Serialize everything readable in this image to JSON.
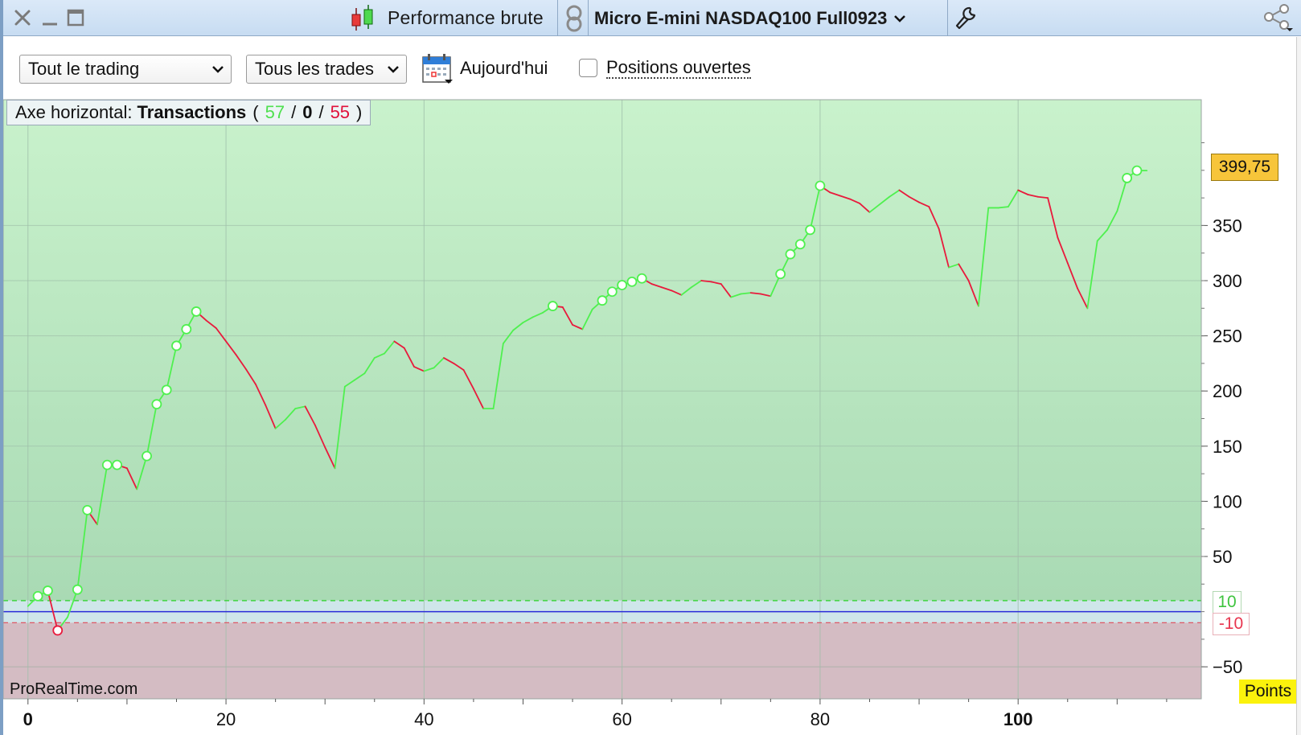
{
  "titlebar": {
    "panel_title": "Performance brute",
    "instrument": "Micro E-mini NASDAQ100 Full0923"
  },
  "toolbar": {
    "period_select": "Tout le trading",
    "trades_select": "Tous les trades",
    "today_label": "Aujourd'hui",
    "open_positions_label": "Positions ouvertes",
    "open_positions_checked": false
  },
  "axis_info": {
    "prefix": "Axe horizontal:",
    "mode": "Transactions",
    "open_paren": "(",
    "wins": "57",
    "sep1": "/",
    "neutral": "0",
    "sep2": "/",
    "losses": "55",
    "close_paren": ")"
  },
  "watermark": "ProRealTime.com",
  "units": "Points",
  "last_value_label": "399,75",
  "upper_threshold_label": "10",
  "lower_threshold_label": "-10",
  "colors": {
    "gain": "#4ff04f",
    "loss": "#e81a3c",
    "badge": "#f7c53a"
  },
  "chart_data": {
    "type": "line",
    "x_ticks": [
      {
        "value": 0,
        "label": "0",
        "major": true
      },
      {
        "value": 20,
        "label": "20",
        "major": false
      },
      {
        "value": 40,
        "label": "40",
        "major": false
      },
      {
        "value": 60,
        "label": "60",
        "major": false
      },
      {
        "value": 80,
        "label": "80",
        "major": false
      },
      {
        "value": 100,
        "label": "100",
        "major": true
      }
    ],
    "y_ticks": [
      {
        "value": 350,
        "label": "350"
      },
      {
        "value": 300,
        "label": "300"
      },
      {
        "value": 250,
        "label": "250"
      },
      {
        "value": 200,
        "label": "200"
      },
      {
        "value": 150,
        "label": "150"
      },
      {
        "value": 100,
        "label": "100"
      },
      {
        "value": 50,
        "label": "50"
      },
      {
        "value": -50,
        "label": "−50"
      }
    ],
    "xlim": [
      -2.5,
      118.5
    ],
    "ylim": [
      -79,
      464
    ],
    "grid": true,
    "upper_threshold": 10,
    "lower_threshold": -10,
    "zero_line": 0,
    "last_value": 399.75,
    "x": [
      0,
      1,
      2,
      3,
      4,
      5,
      6,
      7,
      8,
      9,
      10,
      11,
      12,
      13,
      14,
      15,
      16,
      17,
      18,
      19,
      20,
      21,
      22,
      23,
      24,
      25,
      26,
      27,
      28,
      29,
      30,
      31,
      32,
      33,
      34,
      35,
      36,
      37,
      38,
      39,
      40,
      41,
      42,
      43,
      44,
      45,
      46,
      47,
      48,
      49,
      50,
      51,
      52,
      53,
      54,
      55,
      56,
      57,
      58,
      59,
      60,
      61,
      62,
      63,
      64,
      65,
      66,
      67,
      68,
      69,
      70,
      71,
      72,
      73,
      74,
      75,
      76,
      77,
      78,
      79,
      80,
      81,
      82,
      83,
      84,
      85,
      86,
      87,
      88,
      89,
      90,
      91,
      92,
      93,
      94,
      95,
      96,
      97,
      98,
      99,
      100,
      101,
      102,
      103,
      104,
      105,
      106,
      107,
      108,
      109,
      110,
      111,
      112,
      113
    ],
    "y": [
      5,
      14,
      19,
      -17,
      -5,
      20,
      92,
      79,
      133,
      133,
      130,
      111,
      141,
      188,
      201,
      241,
      256,
      272,
      264,
      257,
      245,
      233,
      220,
      206,
      187,
      166,
      174,
      184,
      186,
      169,
      149,
      130,
      204,
      210,
      216,
      230,
      234,
      245,
      239,
      222,
      218,
      221,
      230,
      225,
      219,
      202,
      184,
      184,
      243,
      255,
      262,
      267,
      271,
      277,
      276,
      260,
      256,
      274,
      282,
      290,
      296,
      299,
      302,
      297,
      294,
      291,
      287,
      294,
      300,
      299,
      297,
      285,
      288,
      289,
      288,
      286,
      306,
      324,
      333,
      346,
      386,
      380,
      377,
      374,
      370,
      362,
      369,
      376,
      382,
      376,
      371,
      367,
      347,
      312,
      315,
      300,
      277,
      366,
      366,
      367,
      382,
      378,
      376,
      375,
      339,
      316,
      293,
      275,
      336,
      346,
      363,
      393,
      399.75,
      399.75
    ],
    "step_markers": [
      1,
      2,
      3,
      5,
      6,
      8,
      9,
      12,
      13,
      14,
      15,
      16,
      17,
      53,
      58,
      59,
      60,
      61,
      62,
      76,
      77,
      78,
      79,
      80,
      111,
      112
    ]
  }
}
